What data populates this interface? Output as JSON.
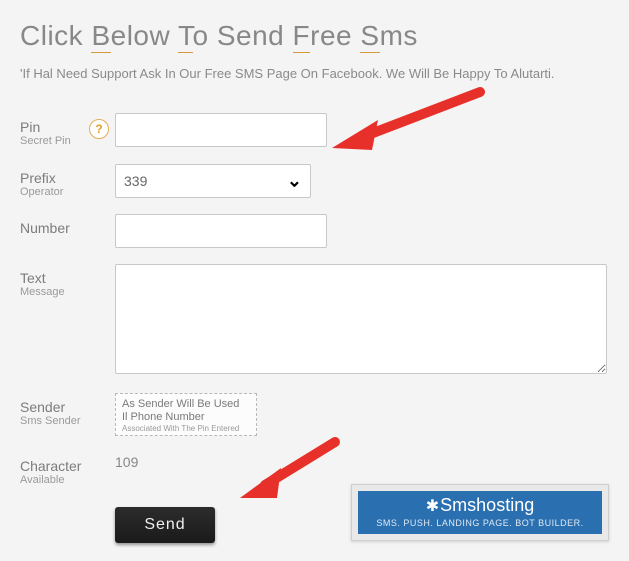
{
  "title_parts": [
    "Click ",
    "B",
    "elow ",
    "T",
    "o Send ",
    "F",
    "ree ",
    "S",
    "ms"
  ],
  "intro": "'If Hal Need Support Ask In Our Free SMS Page On Facebook. We Will Be Happy To Alutarti.",
  "fields": {
    "pin": {
      "label": "Pin",
      "sub": "Secret Pin",
      "value": ""
    },
    "prefix": {
      "label": "Prefix",
      "sub": "Operator",
      "value": "339"
    },
    "number": {
      "label": "Number",
      "value": ""
    },
    "text": {
      "label": "Text",
      "sub": "Message",
      "value": ""
    },
    "sender": {
      "label": "Sender",
      "sub": "Sms Sender",
      "line1": "As Sender Will Be Used",
      "line2": "Il Phone Number",
      "line3": "Associated With The Pin Entered"
    },
    "chars": {
      "label": "Character",
      "sub": "Available",
      "value": "109"
    }
  },
  "help_icon": "?",
  "send_label": "Send",
  "promo": {
    "logo": "Smshosting",
    "tag": "SMS. PUSH. LANDING PAGE. BOT BUILDER."
  }
}
